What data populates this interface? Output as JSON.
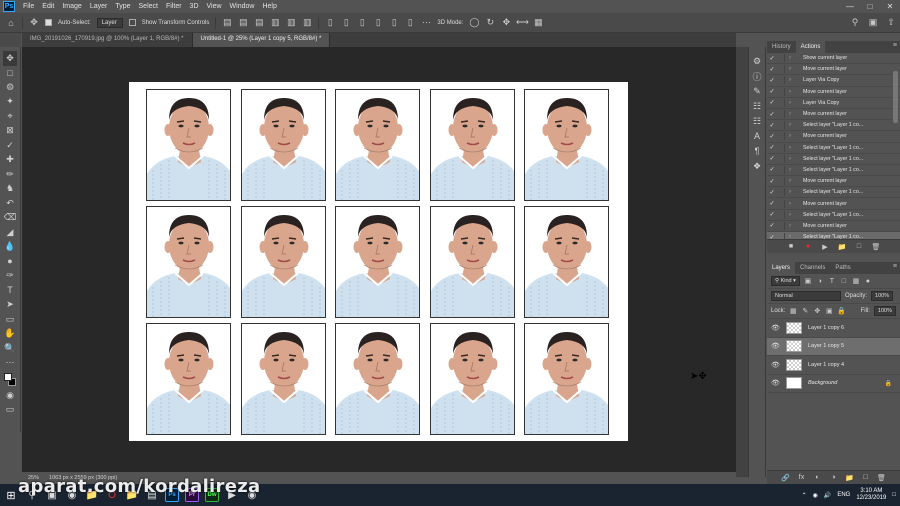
{
  "menubar": {
    "items": [
      "File",
      "Edit",
      "Image",
      "Layer",
      "Type",
      "Select",
      "Filter",
      "3D",
      "View",
      "Window",
      "Help"
    ]
  },
  "options": {
    "auto_select_label": "Auto-Select:",
    "auto_select_value": "Layer",
    "show_transform_label": "Show Transform Controls",
    "mode_3d_label": "3D Mode:"
  },
  "tabs": [
    {
      "label": "IMG_20191026_170919.jpg @ 100% (Layer 1, RGB/8#) *"
    },
    {
      "label": "Untitled-1 @ 25% (Layer 1 copy 5, RGB/8#) *"
    }
  ],
  "status": {
    "zoom": "25%",
    "doc_size": "1063 px x 2559 px (300 ppi)"
  },
  "history_panel": {
    "tab_history": "History",
    "tab_actions": "Actions",
    "actions": [
      "Show current layer",
      "Move current layer",
      "Layer Via Copy",
      "Move current layer",
      "Layer Via Copy",
      "Move current layer",
      "Select layer \"Layer 1 co...",
      "Move current layer",
      "Select layer \"Layer 1 co...",
      "Select layer \"Layer 1 co...",
      "Select layer \"Layer 1 co...",
      "Move current layer",
      "Select layer \"Layer 1 co...",
      "Move current layer",
      "Select layer \"Layer 1 co...",
      "Move current layer",
      "Select layer \"Layer 1 co..."
    ]
  },
  "layers_panel": {
    "tab_layers": "Layers",
    "tab_channels": "Channels",
    "tab_paths": "Paths",
    "kind_label": "Kind",
    "blend_mode": "Normal",
    "opacity_label": "Opacity:",
    "opacity_value": "100%",
    "lock_label": "Lock:",
    "fill_label": "Fill:",
    "fill_value": "100%",
    "layers": [
      {
        "name": "Layer 1 copy 6"
      },
      {
        "name": "Layer 1 copy 5"
      },
      {
        "name": "Layer 1 copy 4"
      },
      {
        "name": "Background"
      }
    ]
  },
  "taskbar": {
    "language": "ENG",
    "time": "3:10 AM",
    "date": "12/23/2019",
    "apps": [
      "Ps",
      "Pr",
      "Dw"
    ]
  },
  "watermark": "aparat.com/kordalireza",
  "colors": {
    "accent_record": "#e0302f",
    "ps_blue": "#31a8ff",
    "shirt": "#cfe1ef",
    "skin": "#d9a58c"
  }
}
